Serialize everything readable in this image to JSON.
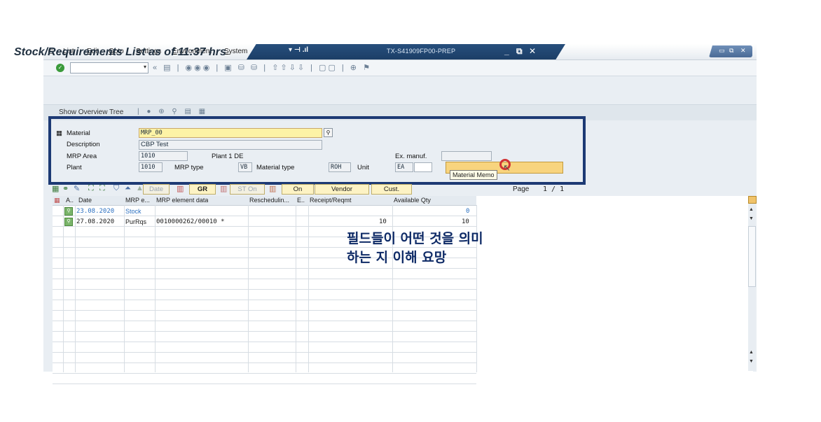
{
  "menu": [
    "List",
    "Edit",
    "Goto",
    "Settings",
    "Environment",
    "System"
  ],
  "window_title": "TX-S41909FP00-PREP",
  "title": "Stock/Requirements List as of 11:37 hrs",
  "appbar": {
    "overview": "Show Overview Tree"
  },
  "header": {
    "material_label": "Material",
    "material_value": "MRP_00",
    "description_label": "Description",
    "description_value": "CBP Test",
    "mrp_area_label": "MRP Area",
    "mrp_area_value": "1010",
    "mrp_area_desc": "Plant 1 DE",
    "plant_label": "Plant",
    "plant_value": "1010",
    "mrp_type_label": "MRP type",
    "mrp_type_value": "VB",
    "material_type_label": "Material type",
    "material_type_value": "ROH",
    "unit_label": "Unit",
    "unit_value": "EA",
    "ex_manuf_label": "Ex. manuf.",
    "memo_tooltip": "Material Memo"
  },
  "grid_buttons": {
    "date": "Date",
    "gr": "GR",
    "st_on": "ST On",
    "on": "On",
    "vendor": "Vendor",
    "cust": "Cust."
  },
  "paging": {
    "label": "Page",
    "value": "1  /  1"
  },
  "table": {
    "headers": [
      "A..",
      "Date",
      "MRP e...",
      "MRP element data",
      "Reschedulin...",
      "E..",
      "Receipt/Reqmt",
      "Available Qty"
    ],
    "rows": [
      {
        "date": "23.08.2020",
        "element": "Stock",
        "data": "",
        "receipt": "",
        "available": "0"
      },
      {
        "date": "27.08.2020",
        "element": "PurRqs",
        "data": "0010000262/00010 *",
        "receipt": "10",
        "available": "10"
      }
    ]
  },
  "overlay_text": [
    "필드들이 어떤 것을 의미",
    "하는 지 이해 요망"
  ],
  "colors": {
    "highlight_box": "#1d3a74",
    "overlay_text": "#0e2a66",
    "title_bar": "#274f7d"
  }
}
